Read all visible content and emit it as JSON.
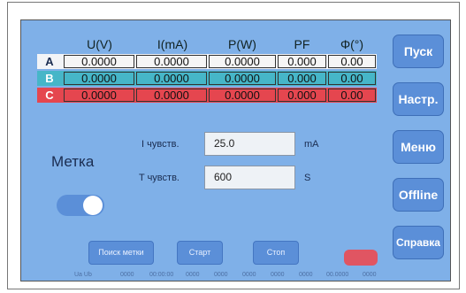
{
  "table": {
    "headers": [
      "U(V)",
      "I(mA)",
      "P(W)",
      "PF",
      "Φ(°)"
    ],
    "rows": [
      {
        "label": "A",
        "values": [
          "0.0000",
          "0.0000",
          "0.0000",
          "0.000",
          "0.00"
        ],
        "color": "#f2f4f7"
      },
      {
        "label": "B",
        "values": [
          "0.0000",
          "0.0000",
          "0.0000",
          "0.000",
          "0.00"
        ],
        "color": "#46b6c8"
      },
      {
        "label": "C",
        "values": [
          "0.0000",
          "0.0000",
          "0.0000",
          "0.000",
          "0.00"
        ],
        "color": "#e5464f"
      }
    ]
  },
  "sidebar": {
    "buttons": [
      "Пуск",
      "Настр.",
      "Меню",
      "Offline",
      "Справка"
    ]
  },
  "metka": {
    "label": "Метка",
    "toggle_on": true
  },
  "params": {
    "i_label": "I чувств.",
    "i_value": "25.0",
    "i_unit": "mA",
    "t_label": "T чувств.",
    "t_value": "600",
    "t_unit": "S"
  },
  "bottom": {
    "buttons": [
      "Поиск метки",
      "Старт",
      "Стоп"
    ],
    "status_items": [
      "Ua Ub",
      "0000",
      "00:00:00",
      "0000",
      "0000",
      "0000",
      "0000",
      "0000",
      "00.0000",
      "0000"
    ]
  },
  "colors": {
    "background": "#7fb0e8",
    "button": "#5b8fd8",
    "row_a": "#f2f4f7",
    "row_b": "#46b6c8",
    "row_c": "#e5464f",
    "indicator": "#e05562"
  }
}
